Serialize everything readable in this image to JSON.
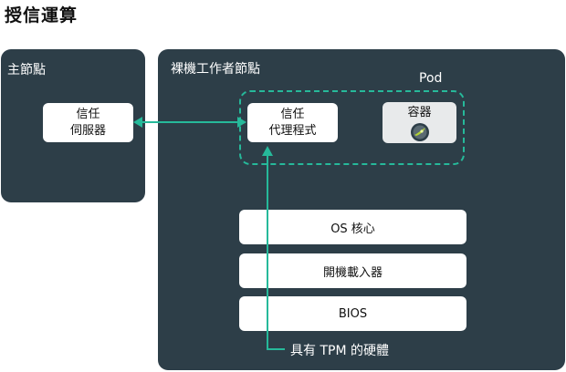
{
  "title": "授信運算",
  "master": {
    "label": "主節點",
    "trust_server": [
      "信任",
      "伺服器"
    ]
  },
  "worker": {
    "label": "裸機工作者節點",
    "pod": {
      "label": "Pod",
      "trust_agent": [
        "信任",
        "代理程式"
      ],
      "container": "容器"
    },
    "layers": [
      "OS 核心",
      "開機載入器",
      "BIOS"
    ],
    "hardware": "具有 TPM 的硬體"
  },
  "colors": {
    "panel": "#2d3e48",
    "accent": "#26b99a",
    "box": "#ffffff",
    "container_box": "#e8eaeb"
  }
}
